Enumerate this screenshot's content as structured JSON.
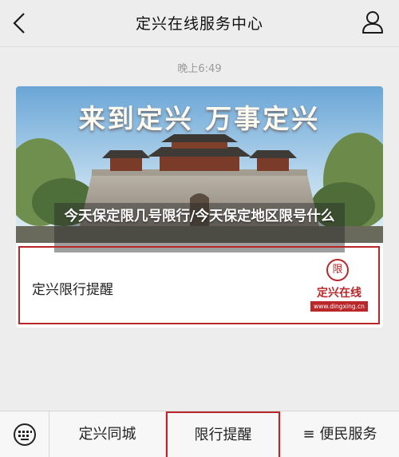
{
  "header": {
    "title": "定兴在线服务中心",
    "back_icon": "chevron-left-icon",
    "profile_icon": "user-icon"
  },
  "chat": {
    "timestamp": "晚上6:49"
  },
  "article_card": {
    "banner_slogan": "来到定兴 万事定兴",
    "overlay_caption": "今天保定限几号限行/今天保定地区限号什么",
    "title": "定兴限行提醒",
    "logo": {
      "seal_char": "限",
      "name": "定兴在线",
      "url": "www.dingxing.cn"
    }
  },
  "bottom_menu": {
    "keyboard_icon": "keyboard-icon",
    "items": [
      {
        "label": "定兴同城"
      },
      {
        "label": "限行提醒"
      },
      {
        "label": "便民服务",
        "icon": "≡"
      }
    ]
  },
  "colors": {
    "accent_red": "#b9272b",
    "background": "#ededed",
    "timestamp_gray": "#9a9a9a"
  }
}
